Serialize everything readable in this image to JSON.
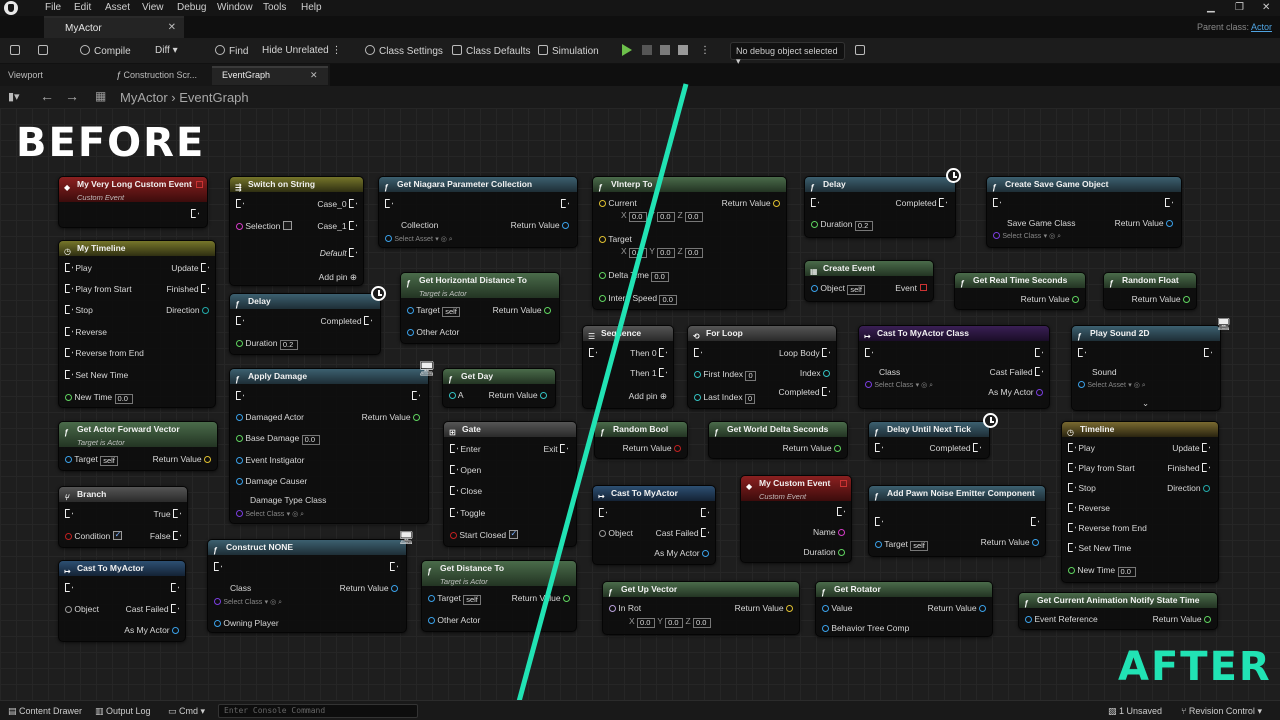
{
  "menu": [
    "File",
    "Edit",
    "Asset",
    "View",
    "Debug",
    "Window",
    "Tools",
    "Help"
  ],
  "doc_tab": "MyActor",
  "parent_class": {
    "label": "Parent class:",
    "value": "Actor"
  },
  "toolbar": {
    "compile": "Compile",
    "diff": "Diff",
    "find": "Find",
    "hide_unrelated": "Hide Unrelated",
    "class_settings": "Class Settings",
    "class_defaults": "Class Defaults",
    "simulation": "Simulation",
    "debug_object": "No debug object selected"
  },
  "panel_tabs": [
    "Viewport",
    "Construction Scr...",
    "EventGraph"
  ],
  "breadcrumb": {
    "root": "MyActor",
    "sep": "›",
    "current": "EventGraph"
  },
  "labels": {
    "before": "BEFORE",
    "after": "AFTER"
  },
  "divider_color": "#21e3b4",
  "nodes": {
    "custom_event": {
      "title": "My Very Long Custom Event",
      "sub": "Custom Event"
    },
    "timeline_l": {
      "title": "My Timeline",
      "pins_in": [
        "Play",
        "Play from Start",
        "Stop",
        "Reverse",
        "Reverse from End",
        "Set New Time",
        "New Time"
      ],
      "pins_out": [
        "Update",
        "Finished",
        "Direction"
      ],
      "new_time": "0.0"
    },
    "get_fwd": {
      "title": "Get Actor Forward Vector",
      "sub": "Target is Actor",
      "target": "Target",
      "self": "self",
      "ret": "Return Value"
    },
    "branch": {
      "title": "Branch",
      "true": "True",
      "false": "False",
      "cond": "Condition"
    },
    "cast_l": {
      "title": "Cast To MyActor",
      "object": "Object",
      "failed": "Cast Failed",
      "as": "As My Actor"
    },
    "switch": {
      "title": "Switch on String",
      "sel": "Selection",
      "c0": "Case_0",
      "c1": "Case_1",
      "def": "Default",
      "add": "Add pin"
    },
    "delay_l": {
      "title": "Delay",
      "completed": "Completed",
      "duration": "Duration",
      "val": "0.2"
    },
    "apply_dmg": {
      "title": "Apply Damage",
      "actor": "Damaged Actor",
      "base": "Base Damage",
      "base_val": "0.0",
      "inst": "Event Instigator",
      "causer": "Damage Causer",
      "type": "Damage Type Class",
      "sel": "Select Class",
      "ret": "Return Value"
    },
    "construct": {
      "title": "Construct NONE",
      "class": "Class",
      "sel": "Select Class",
      "owner": "Owning Player",
      "ret": "Return Value"
    },
    "niagara": {
      "title": "Get Niagara Parameter Collection",
      "coll": "Collection",
      "sel": "Select Asset",
      "ret": "Return Value"
    },
    "horiz": {
      "title": "Get Horizontal Distance To",
      "sub": "Target is Actor",
      "target": "Target",
      "self": "self",
      "other": "Other Actor",
      "ret": "Return Value"
    },
    "get_day": {
      "title": "Get Day",
      "a": "A",
      "ret": "Return Value"
    },
    "gate": {
      "title": "Gate",
      "enter": "Enter",
      "open": "Open",
      "close": "Close",
      "toggle": "Toggle",
      "start": "Start Closed",
      "exit": "Exit"
    },
    "get_dist": {
      "title": "Get Distance To",
      "sub": "Target is Actor",
      "target": "Target",
      "self": "self",
      "other": "Other Actor",
      "ret": "Return Value"
    },
    "vinterp": {
      "title": "VInterp To",
      "current": "Current",
      "target": "Target",
      "delta": "Delta Time",
      "speed": "Interp Speed",
      "ret": "Return Value",
      "zero": "0.0"
    },
    "sequence": {
      "title": "Sequence",
      "t0": "Then 0",
      "t1": "Then 1",
      "add": "Add pin"
    },
    "rand_bool": {
      "title": "Random Bool",
      "ret": "Return Value"
    },
    "cast_r": {
      "title": "Cast To MyActor",
      "object": "Object",
      "failed": "Cast Failed",
      "as": "As My Actor"
    },
    "get_up": {
      "title": "Get Up Vector",
      "inrot": "In Rot",
      "ret": "Return Value",
      "zero": "0.0"
    },
    "delay_r": {
      "title": "Delay",
      "completed": "Completed",
      "duration": "Duration",
      "val": "0.2"
    },
    "create_event": {
      "title": "Create Event",
      "object": "Object",
      "self": "self",
      "event": "Event"
    },
    "for_loop": {
      "title": "For Loop",
      "first": "First Index",
      "last": "Last Index",
      "body": "Loop Body",
      "index": "Index",
      "completed": "Completed",
      "zero": "0"
    },
    "world_delta": {
      "title": "Get World Delta Seconds",
      "ret": "Return Value"
    },
    "my_custom": {
      "title": "My Custom Event",
      "sub": "Custom Event",
      "name": "Name",
      "duration": "Duration"
    },
    "get_rot": {
      "title": "Get Rotator",
      "value": "Value",
      "btc": "Behavior Tree Comp",
      "ret": "Return Value"
    },
    "create_save": {
      "title": "Create Save Game Object",
      "cls": "Save Game Class",
      "sel": "Select Class",
      "ret": "Return Value"
    },
    "real_time": {
      "title": "Get Real Time Seconds",
      "ret": "Return Value"
    },
    "rand_float": {
      "title": "Random Float",
      "ret": "Return Value"
    },
    "cast_class": {
      "title": "Cast To MyActor Class",
      "class": "Class",
      "sel": "Select Class",
      "failed": "Cast Failed",
      "as": "As My Actor"
    },
    "delay_next": {
      "title": "Delay Until Next Tick",
      "completed": "Completed"
    },
    "pawn_noise": {
      "title": "Add Pawn Noise Emitter Component",
      "target": "Target",
      "self": "self",
      "ret": "Return Value"
    },
    "play_sound": {
      "title": "Play Sound 2D",
      "sound": "Sound",
      "sel": "Select Asset"
    },
    "timeline_r": {
      "title": "Timeline",
      "pins_in": [
        "Play",
        "Play from Start",
        "Stop",
        "Reverse",
        "Reverse from End",
        "Set New Time",
        "New Time"
      ],
      "pins_out": [
        "Update",
        "Finished",
        "Direction"
      ],
      "new_time": "0.0"
    },
    "anim_notify": {
      "title": "Get Current Animation Notify State Time",
      "ref": "Event Reference",
      "ret": "Return Value"
    }
  },
  "status": {
    "content": "Content Drawer",
    "output": "Output Log",
    "cmd": "Cmd",
    "console_ph": "Enter Console Command",
    "unsaved": "1 Unsaved",
    "revision": "Revision Control"
  }
}
